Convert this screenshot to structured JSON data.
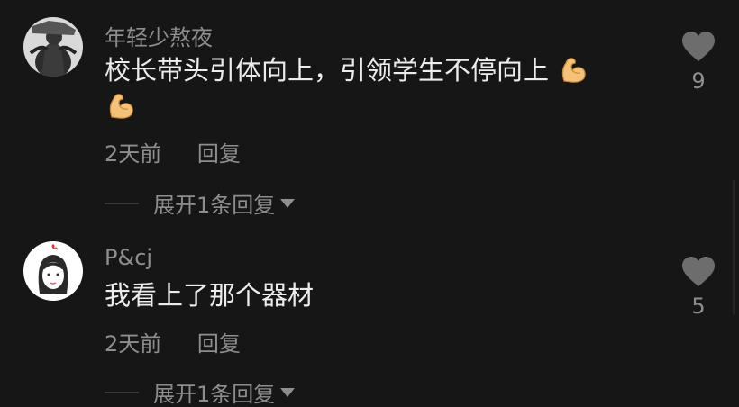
{
  "comments": [
    {
      "username": "年轻少熬夜",
      "text_line1": "校长带头引体向上，引领学生不停向上",
      "emoji": "flexed-biceps",
      "time": "2天前",
      "reply": "回复",
      "expand_replies": "展开1条回复",
      "likes": "9"
    },
    {
      "username": "P&cj",
      "text_line1": "我看上了那个器材",
      "time": "2天前",
      "reply": "回复",
      "expand_replies": "展开1条回复",
      "likes": "5"
    }
  ],
  "colors": {
    "background": "#161616",
    "primary_text": "#ececec",
    "secondary_text": "#8e8e8e"
  }
}
